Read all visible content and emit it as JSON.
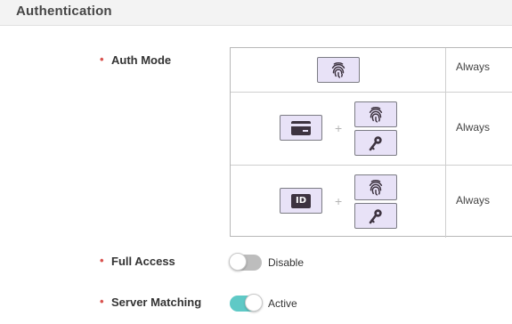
{
  "section": {
    "title": "Authentication"
  },
  "fields": {
    "auth_mode": {
      "label": "Auth Mode"
    },
    "full_access": {
      "label": "Full Access",
      "state_label": "Disable",
      "enabled": false
    },
    "server_matching": {
      "label": "Server Matching",
      "state_label": "Active",
      "enabled": true
    }
  },
  "auth_modes": [
    {
      "credentials": [
        "fingerprint-icon"
      ],
      "schedule": "Always"
    },
    {
      "credentials": [
        "card-icon",
        "plus",
        [
          "fingerprint-icon",
          "pin-key-icon"
        ]
      ],
      "schedule": "Always"
    },
    {
      "credentials": [
        "id-icon",
        "plus",
        [
          "fingerprint-icon",
          "pin-key-icon"
        ]
      ],
      "schedule": "Always"
    }
  ],
  "icons": {
    "id_text": "ID",
    "plus_symbol": "+"
  },
  "colors": {
    "required_marker": "#d9534f",
    "credential_box_bg": "#e8e2f7",
    "icon_dark": "#3d3340",
    "toggle_off": "#bdbdbd",
    "toggle_on": "#5fc9c6"
  }
}
